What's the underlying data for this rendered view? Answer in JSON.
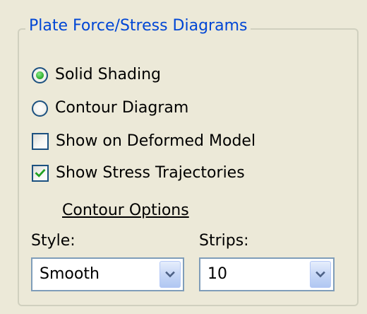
{
  "group": {
    "title": "Plate Force/Stress Diagrams"
  },
  "options": {
    "solid_shading": {
      "label": "Solid Shading",
      "selected": true
    },
    "contour_diagram": {
      "label": "Contour Diagram",
      "selected": false
    },
    "show_deformed": {
      "label": "Show on Deformed Model",
      "checked": false
    },
    "show_trajectories": {
      "label": "Show Stress Trajectories",
      "checked": true
    }
  },
  "contour_options": {
    "label": "Contour Options"
  },
  "style": {
    "label": "Style:",
    "value": "Smooth"
  },
  "strips": {
    "label": "Strips:",
    "value": "10"
  },
  "icons": {
    "radio_selected": "radio-selected-icon",
    "radio_unselected": "radio-unselected-icon",
    "checkbox_checked": "checkmark-icon",
    "dropdown": "chevron-down-icon"
  },
  "colors": {
    "background": "#ECE9D8",
    "group_title": "#0046D5",
    "control_border": "#1C5180",
    "radio_dot": "#35B535",
    "checkmark": "#21A121",
    "dropdown_arrow": "#4D6185"
  }
}
